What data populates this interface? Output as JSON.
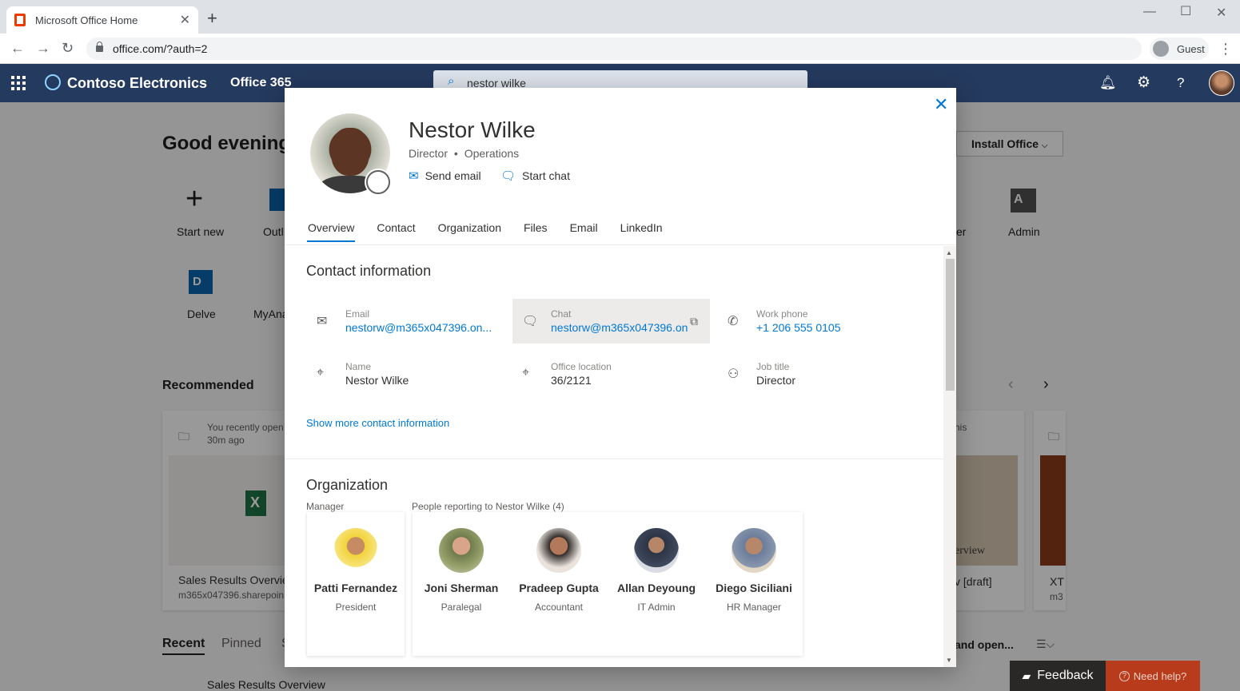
{
  "browser": {
    "tab_title": "Microsoft Office Home",
    "url": "office.com/?auth=2",
    "profile_label": "Guest"
  },
  "header": {
    "org_name": "Contoso Electronics",
    "suite_name": "Office 365",
    "search_query": "nestor wilke"
  },
  "background": {
    "greeting": "Good evening",
    "install_office": "Install Office",
    "apps": [
      {
        "label": "Start new"
      },
      {
        "label": "Outl"
      },
      {
        "label": "er"
      },
      {
        "label": "Admin"
      },
      {
        "label": "Delve"
      },
      {
        "label": "MyAna"
      }
    ],
    "recommended_title": "Recommended",
    "rec_card1_line1": "You recently open",
    "rec_card1_line2": "30m ago",
    "rec_card1_file": "Sales Results Overvie",
    "rec_card1_site": "m365x047396.sharepoin",
    "rec_card2_tail": "his",
    "rec_card2_file": "v [draft]",
    "rec_card2_preview": "erview",
    "rec_card3_file": "XT",
    "rec_card3_site": "m3",
    "tabs": [
      "Recent",
      "Pinned",
      "S"
    ],
    "upload_open": "and open...",
    "recent_file": "Sales Results Overview"
  },
  "profile": {
    "name": "Nestor Wilke",
    "title": "Director",
    "department": "Operations",
    "actions": {
      "send_email": "Send email",
      "start_chat": "Start chat"
    },
    "tabs": [
      "Overview",
      "Contact",
      "Organization",
      "Files",
      "Email",
      "LinkedIn"
    ],
    "contact_section_title": "Contact information",
    "contact": {
      "email_label": "Email",
      "email_value": "nestorw@m365x047396.on...",
      "chat_label": "Chat",
      "chat_value": "nestorw@m365x047396.on",
      "phone_label": "Work phone",
      "phone_value": "+1 206 555 0105",
      "name_label": "Name",
      "name_value": "Nestor Wilke",
      "office_label": "Office location",
      "office_value": "36/2121",
      "job_label": "Job title",
      "job_value": "Director"
    },
    "show_more": "Show more contact information",
    "org_section_title": "Organization",
    "manager_label": "Manager",
    "reports_label": "People reporting to Nestor Wilke (4)",
    "manager": {
      "name": "Patti Fernandez",
      "role": "President"
    },
    "reports": [
      {
        "name": "Joni Sherman",
        "role": "Paralegal"
      },
      {
        "name": "Pradeep Gupta",
        "role": "Accountant"
      },
      {
        "name": "Allan Deyoung",
        "role": "IT Admin"
      },
      {
        "name": "Diego Siciliani",
        "role": "HR Manager"
      }
    ]
  },
  "footer": {
    "feedback": "Feedback",
    "need_help": "Need help?"
  },
  "colors": {
    "accent": "#0078d4",
    "header_bg": "#243a5e",
    "help_bg": "#b83c1c"
  }
}
